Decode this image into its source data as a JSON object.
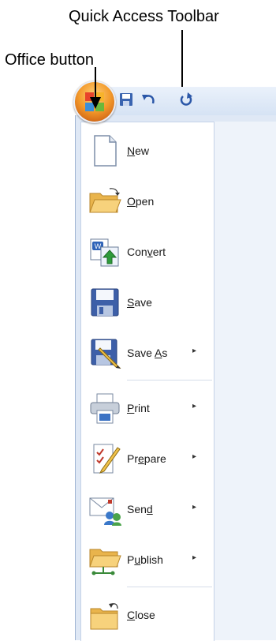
{
  "annotations": {
    "qat_label": "Quick Access Toolbar",
    "office_label": "Office button"
  },
  "office_button": {
    "icon": "office-logo-icon"
  },
  "qat": {
    "items": [
      {
        "name": "save-qat-button",
        "icon": "save-icon"
      },
      {
        "name": "undo-qat-button",
        "icon": "undo-icon"
      },
      {
        "name": "redo-qat-button",
        "icon": "redo-icon"
      }
    ]
  },
  "menu": {
    "items": [
      {
        "pre": "",
        "u": "N",
        "post": "ew",
        "submenu": false,
        "icon": "new-document-icon"
      },
      {
        "pre": "",
        "u": "O",
        "post": "pen",
        "submenu": false,
        "icon": "open-folder-icon"
      },
      {
        "pre": "Con",
        "u": "v",
        "post": "ert",
        "submenu": false,
        "icon": "convert-icon"
      },
      {
        "pre": "",
        "u": "S",
        "post": "ave",
        "submenu": false,
        "icon": "save-icon"
      },
      {
        "pre": "Save ",
        "u": "A",
        "post": "s",
        "submenu": true,
        "icon": "save-as-icon"
      },
      {
        "pre": "",
        "u": "P",
        "post": "rint",
        "submenu": true,
        "icon": "printer-icon"
      },
      {
        "pre": "Pr",
        "u": "e",
        "post": "pare",
        "submenu": true,
        "icon": "prepare-icon"
      },
      {
        "pre": "Sen",
        "u": "d",
        "post": "",
        "submenu": true,
        "icon": "send-icon"
      },
      {
        "pre": "P",
        "u": "u",
        "post": "blish",
        "submenu": true,
        "icon": "publish-icon"
      },
      {
        "pre": "",
        "u": "C",
        "post": "lose",
        "submenu": false,
        "icon": "close-folder-icon"
      }
    ],
    "submenu_glyph": "▸"
  }
}
